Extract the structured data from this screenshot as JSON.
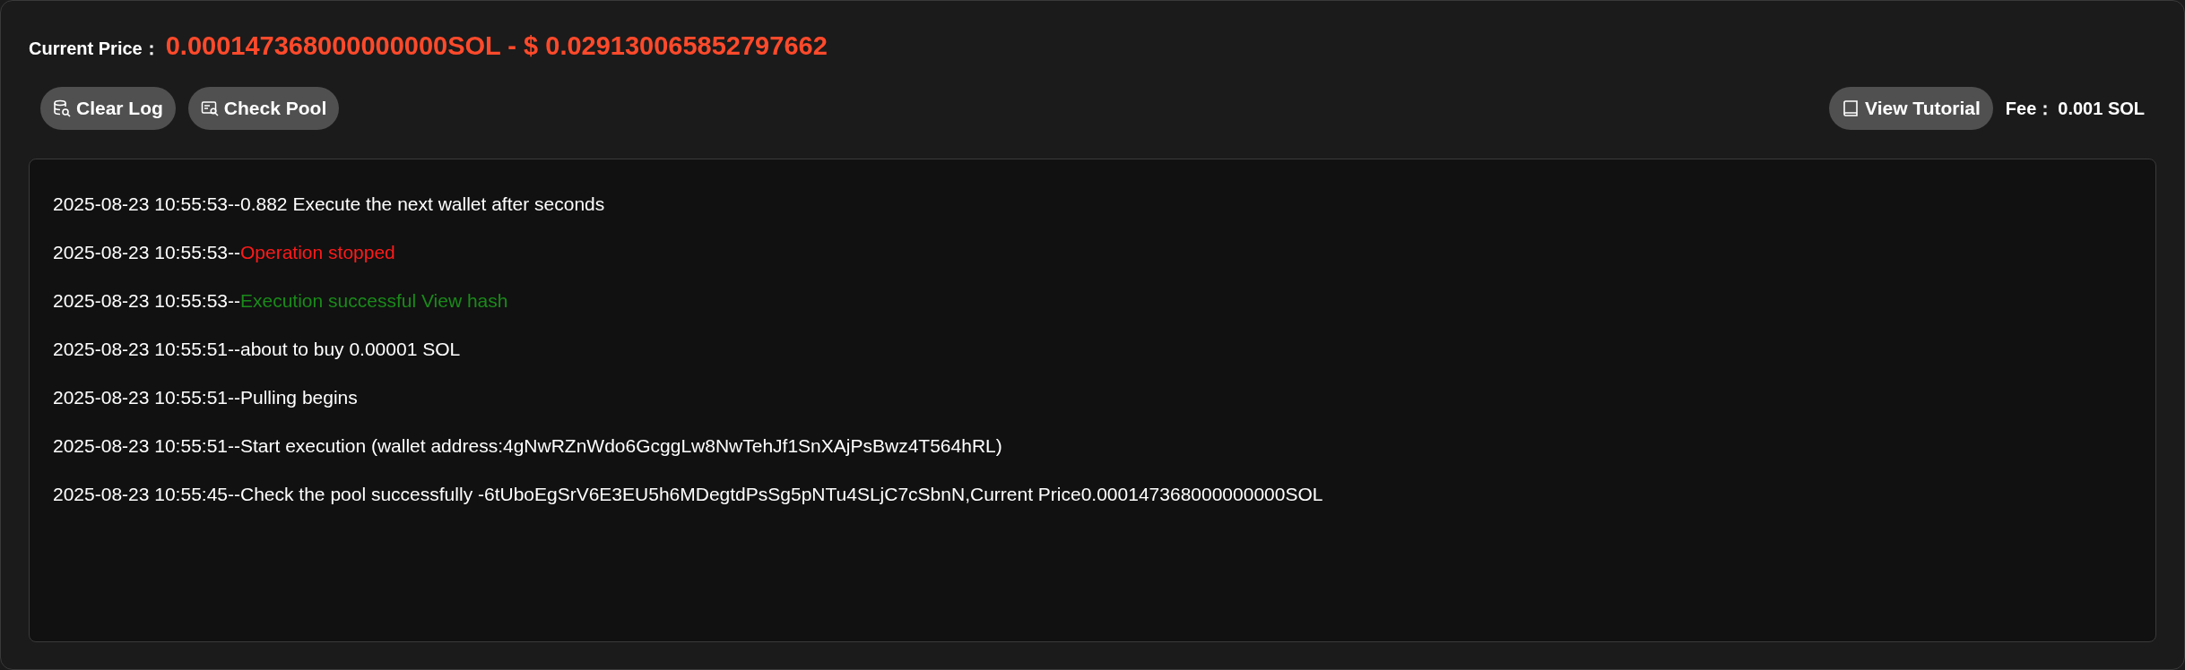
{
  "price": {
    "label": "Current Price：",
    "value": "0.000147368000000000SOL - $ 0.029130065852797662"
  },
  "buttons": [
    {
      "label": "Clear Log"
    },
    {
      "label": "Check Pool"
    }
  ],
  "tutorial_button": {
    "label": "View Tutorial"
  },
  "fee": {
    "label": "Fee：",
    "value": "0.001 SOL"
  },
  "log": [
    {
      "time": "2025-08-23 10:55:53--",
      "message": "0.882 Execute the next wallet after seconds",
      "kind": "info"
    },
    {
      "time": "2025-08-23 10:55:53--",
      "message": "Operation stopped",
      "kind": "error"
    },
    {
      "time": "2025-08-23 10:55:53--",
      "message": "Execution successful View hash",
      "kind": "success"
    },
    {
      "time": "2025-08-23 10:55:51--",
      "message": "about to buy 0.00001 SOL",
      "kind": "info"
    },
    {
      "time": "2025-08-23 10:55:51--",
      "message": "Pulling begins",
      "kind": "info"
    },
    {
      "time": "2025-08-23 10:55:51--",
      "message": "Start execution (wallet address:4gNwRZnWdo6GcggLw8NwTehJf1SnXAjPsBwz4T564hRL)",
      "kind": "info"
    },
    {
      "time": "2025-08-23 10:55:45--",
      "message": "Check the pool successfully -6tUboEgSrV6E3EU5h6MDegtdPsSg5pNTu4SLjC7cSbnN,Current Price0.000147368000000000SOL",
      "kind": "info"
    }
  ]
}
